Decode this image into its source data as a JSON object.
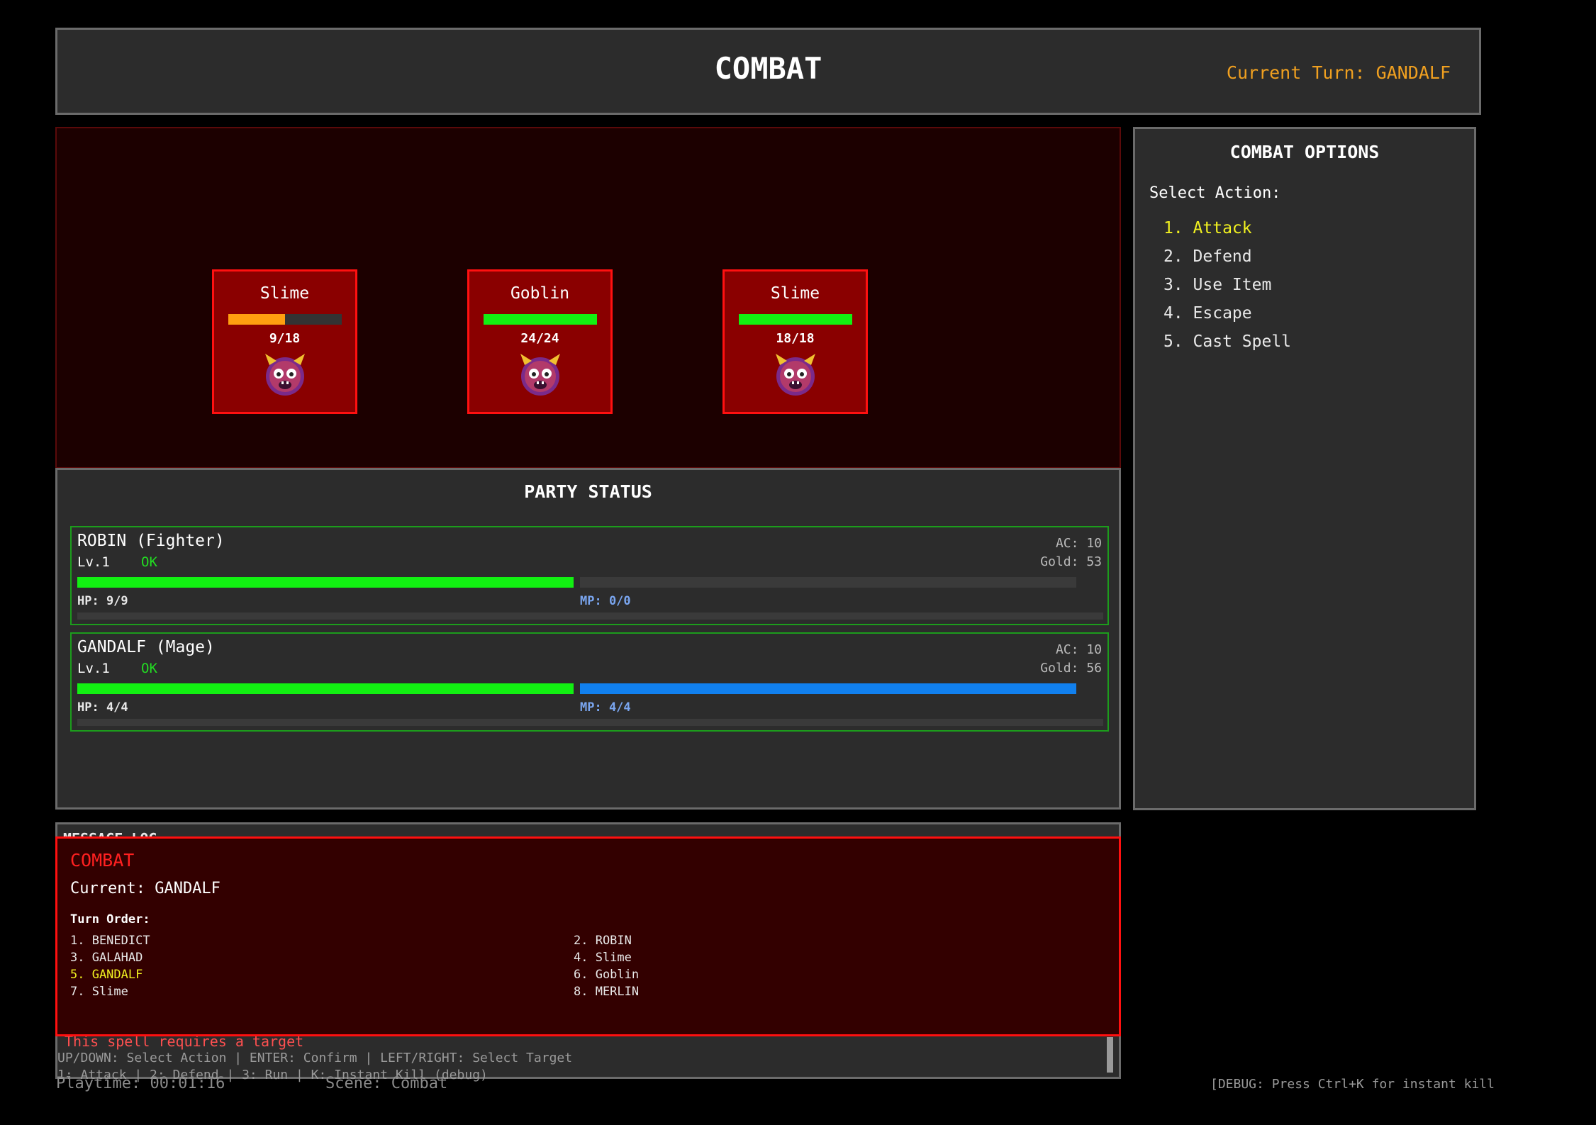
{
  "header": {
    "title": "COMBAT",
    "current_turn": "Current Turn: GANDALF"
  },
  "enemies": [
    {
      "name": "Slime",
      "hp_text": "9/18",
      "hp_fraction": 0.5,
      "bar_color": "#ff9f10",
      "icon": "ogre-face-icon"
    },
    {
      "name": "Goblin",
      "hp_text": "24/24",
      "hp_fraction": 1.0,
      "bar_color": "#12f012",
      "icon": "ogre-face-icon"
    },
    {
      "name": "Slime",
      "hp_text": "18/18",
      "hp_fraction": 1.0,
      "bar_color": "#12f012",
      "icon": "ogre-face-icon"
    }
  ],
  "party": {
    "title": "PARTY STATUS",
    "members": [
      {
        "name": "ROBIN (Fighter)",
        "level": "Lv.1",
        "status": "OK",
        "ac": "AC: 10",
        "gold": "Gold: 53",
        "hp": "HP: 9/9",
        "mp": "MP: 0/0",
        "hp_fraction": 1.0,
        "mp_fraction": 0.0
      },
      {
        "name": "GANDALF (Mage)",
        "level": "Lv.1",
        "status": "OK",
        "ac": "AC: 10",
        "gold": "Gold: 56",
        "hp": "HP: 4/4",
        "mp": "MP: 4/4",
        "hp_fraction": 1.0,
        "mp_fraction": 1.0
      }
    ]
  },
  "options": {
    "title": "COMBAT OPTIONS",
    "label": "Select Action:",
    "items": [
      "1. Attack",
      "2. Defend",
      "3. Use Item",
      "4. Escape",
      "5. Cast Spell"
    ],
    "selected_index": 0
  },
  "log": {
    "title": "MESSAGE LOG",
    "message": "This spell requires a target",
    "help1": "UP/DOWN: Select Action | ENTER: Confirm | LEFT/RIGHT: Select Target",
    "help2": "1: Attack | 2: Defend | 3: Run | K: Instant Kill (debug)"
  },
  "footer": {
    "playtime": "Playtime: 00:01:16",
    "scene": "Scene: Combat",
    "debug": "[DEBUG: Press Ctrl+K for instant kill]"
  },
  "overlay": {
    "title": "COMBAT",
    "current": "Current: GANDALF",
    "turn_order_label": "Turn Order:",
    "turn_order": [
      "1. BENEDICT",
      "2. ROBIN",
      "3. GALAHAD",
      "4. Slime",
      "5. GANDALF",
      "6. Goblin",
      "7. Slime",
      "8. MERLIN"
    ],
    "active_index": 4
  }
}
